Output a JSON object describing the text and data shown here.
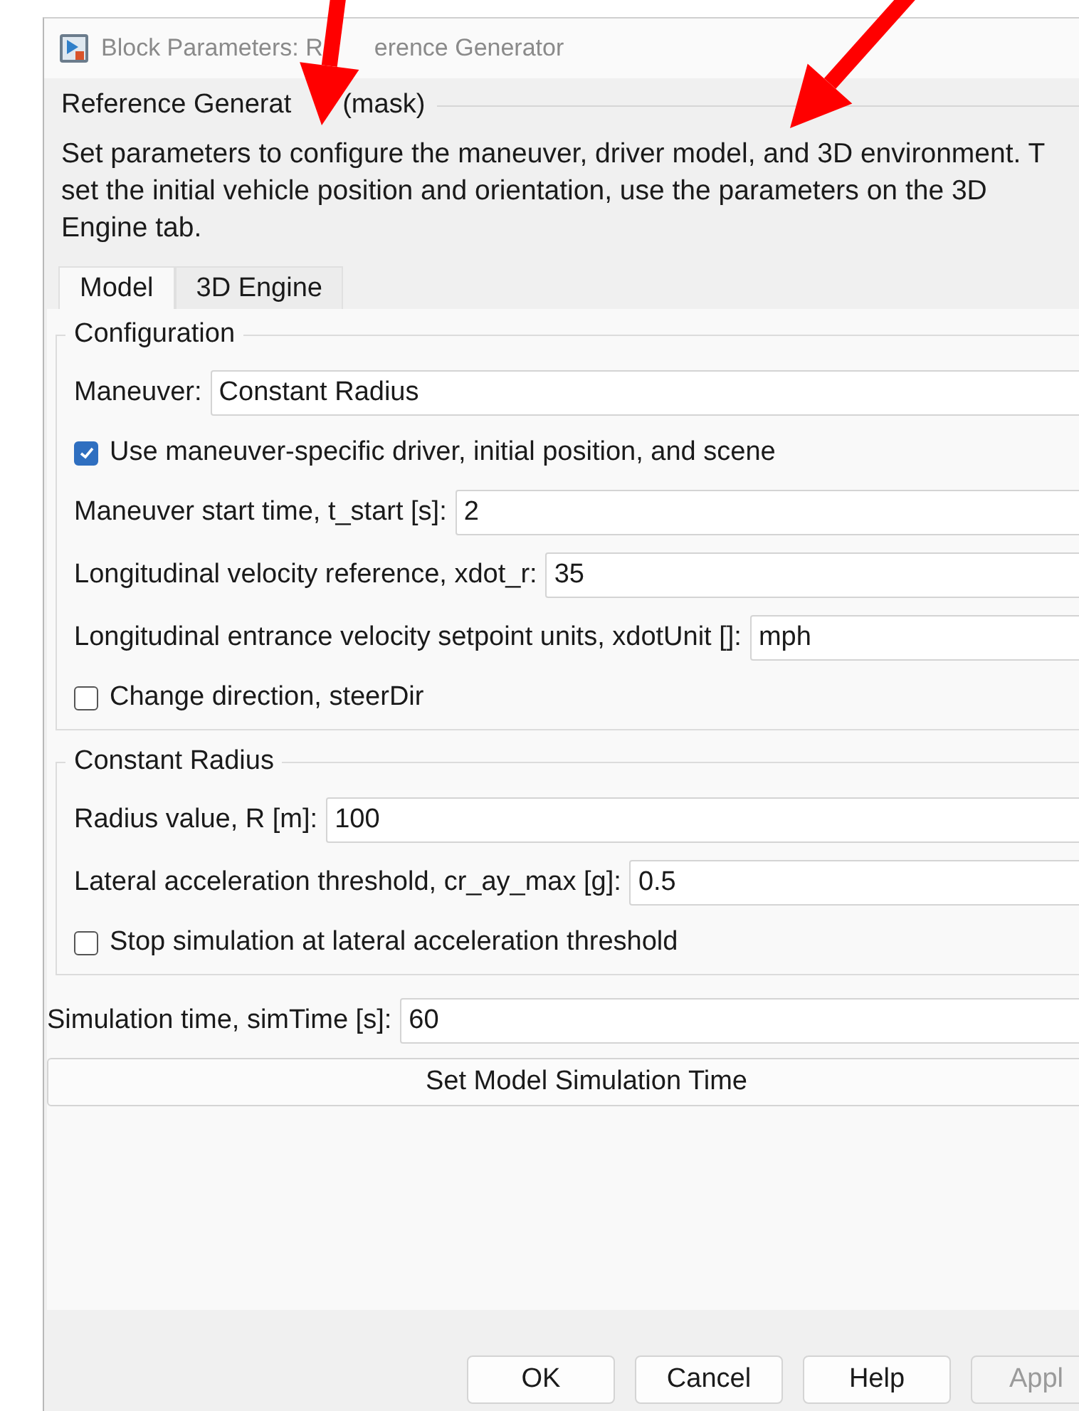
{
  "window": {
    "title_parts": [
      "Block Parameters: R",
      "erence Generator"
    ]
  },
  "mask_title_parts": [
    "Reference Generat",
    "(mask)"
  ],
  "description_lines": [
    "Set parameters to configure the maneuver, driver model, and 3D environment. T",
    "set the initial vehicle position and orientation, use the parameters on the 3D",
    "Engine tab."
  ],
  "tabs": [
    {
      "label": "Model",
      "selected": true
    },
    {
      "label": "3D Engine",
      "selected": false
    }
  ],
  "groups": [
    {
      "title": "Configuration",
      "rows": [
        {
          "kind": "dropdown",
          "label": "Maneuver:",
          "value": "Constant Radius"
        },
        {
          "kind": "checkbox",
          "label": "Use maneuver-specific driver, initial position, and scene",
          "checked": true
        },
        {
          "kind": "field",
          "label": "Maneuver start time, t_start [s]:",
          "value": "2"
        },
        {
          "kind": "field",
          "label": "Longitudinal velocity reference, xdot_r:",
          "value": "35"
        },
        {
          "kind": "field",
          "label": "Longitudinal entrance velocity setpoint units, xdotUnit []:",
          "value": "mph"
        },
        {
          "kind": "checkbox",
          "label": "Change direction, steerDir",
          "checked": false
        }
      ]
    },
    {
      "title": "Constant Radius",
      "rows": [
        {
          "kind": "field",
          "label": "Radius value, R [m]:",
          "value": "100"
        },
        {
          "kind": "field",
          "label": "Lateral acceleration threshold, cr_ay_max [g]:",
          "value": "0.5"
        },
        {
          "kind": "checkbox",
          "label": "Stop simulation at lateral acceleration threshold",
          "checked": false
        }
      ]
    }
  ],
  "sim_time": {
    "label": "Simulation time, simTime [s]:",
    "value": "60"
  },
  "set_time_button": "Set Model Simulation Time",
  "buttons": [
    {
      "label": "OK",
      "disabled": false
    },
    {
      "label": "Cancel",
      "disabled": false
    },
    {
      "label": "Help",
      "disabled": false
    },
    {
      "label": "Appl",
      "disabled": true
    }
  ],
  "annotations": [
    {
      "kind": "arrow"
    },
    {
      "kind": "arrow"
    }
  ]
}
